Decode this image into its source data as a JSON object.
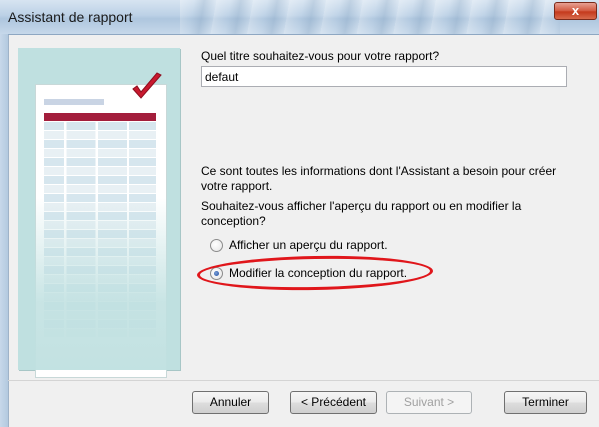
{
  "window": {
    "title": "Assistant de rapport",
    "close_glyph": "x"
  },
  "content": {
    "title_prompt": "Quel titre souhaitez-vous pour votre rapport?",
    "title_value": "defaut",
    "info_text": "Ce sont toutes les informations dont l'Assistant a besoin pour créer votre rapport.",
    "question_text": "Souhaitez-vous afficher l'aperçu du rapport ou en modifier la conception?",
    "options": [
      {
        "label": "Afficher un aperçu du rapport.",
        "selected": false
      },
      {
        "label": "Modifier la conception du rapport.",
        "selected": true
      }
    ]
  },
  "buttons": {
    "cancel": "Annuler",
    "previous": "< Précédent",
    "next": "Suivant >",
    "finish": "Terminer"
  },
  "illustration": {
    "icon": "report-checkmark-icon"
  },
  "colors": {
    "highlight_ellipse": "#e0161b",
    "checkmark": "#c8192e",
    "illustration_bg": "#bfe0e0"
  }
}
